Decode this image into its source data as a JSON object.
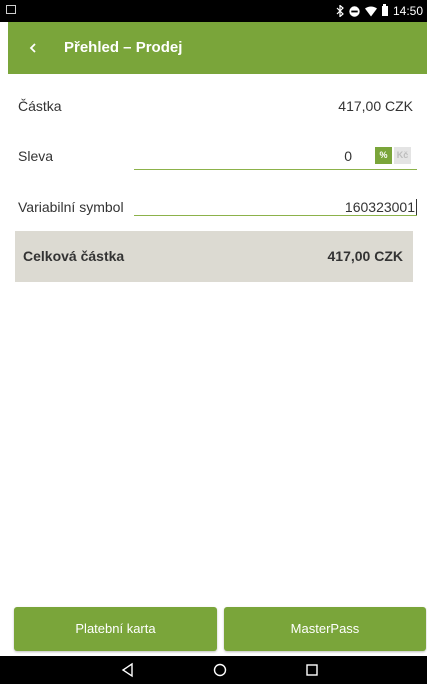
{
  "status_bar": {
    "time": "14:50",
    "icons": [
      "screenshot-icon",
      "bluetooth-icon",
      "do-not-disturb-icon",
      "wifi-icon",
      "battery-icon"
    ]
  },
  "app_bar": {
    "back_icon": "back-chevron-icon",
    "title": "Přehled – Prodej",
    "color": "#7aa53a"
  },
  "form": {
    "amount": {
      "label": "Částka",
      "value": "417,00 CZK"
    },
    "discount": {
      "label": "Sleva",
      "value": "0",
      "toggle_percent": "%",
      "toggle_currency": "Kč",
      "selected": "%"
    },
    "variable_symbol": {
      "label": "Variabilní symbol",
      "value": "160323001"
    }
  },
  "total": {
    "label": "Celková částka",
    "value": "417,00 CZK",
    "background": "#dcdad2"
  },
  "buttons": {
    "card": "Platební karta",
    "masterpass": "MasterPass"
  },
  "nav_bar": {
    "icons": [
      "back-triangle-icon",
      "home-circle-icon",
      "recents-square-icon"
    ]
  }
}
